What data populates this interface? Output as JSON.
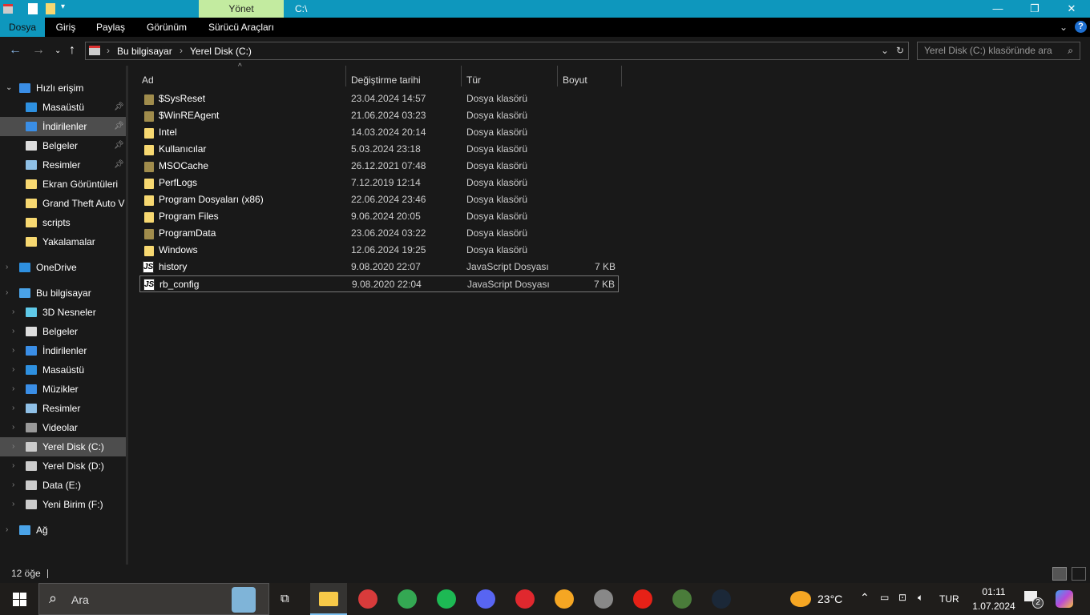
{
  "titlebar": {
    "context_tab": "Yönet",
    "title": "C:\\",
    "minimize": "—",
    "maximize": "❐",
    "close": "✕"
  },
  "ribbon": {
    "tabs": [
      "Dosya",
      "Giriş",
      "Paylaş",
      "Görünüm",
      "Sürücü Araçları"
    ],
    "help": "?",
    "collapse": "⌄"
  },
  "address": {
    "breadcrumbs": [
      "Bu bilgisayar",
      "Yerel Disk (C:)"
    ],
    "search_placeholder": "Yerel Disk (C:) klasöründe ara"
  },
  "sidebar": {
    "items": [
      {
        "label": "Hızlı erişim",
        "level": 0,
        "icon": "star-icon",
        "color": "#3a8ee6"
      },
      {
        "label": "Masaüstü",
        "level": 1,
        "icon": "desktop-icon",
        "color": "#2e90e0",
        "pinned": true
      },
      {
        "label": "İndirilenler",
        "level": 1,
        "icon": "download-icon",
        "color": "#3a8ee6",
        "pinned": true,
        "selected": true
      },
      {
        "label": "Belgeler",
        "level": 1,
        "icon": "document-icon",
        "color": "#dddddd",
        "pinned": true
      },
      {
        "label": "Resimler",
        "level": 1,
        "icon": "pictures-icon",
        "color": "#8fc0e6",
        "pinned": true
      },
      {
        "label": "Ekran Görüntüleri",
        "level": 1,
        "icon": "folder-icon",
        "color": "#f7d871"
      },
      {
        "label": "Grand Theft Auto V",
        "level": 1,
        "icon": "folder-icon",
        "color": "#f7d871"
      },
      {
        "label": "scripts",
        "level": 1,
        "icon": "folder-icon",
        "color": "#f7d871"
      },
      {
        "label": "Yakalamalar",
        "level": 1,
        "icon": "folder-icon",
        "color": "#f7d871"
      },
      {
        "label": "OneDrive",
        "level": 0,
        "icon": "cloud-icon",
        "color": "#2e90e0",
        "gap": true
      },
      {
        "label": "Bu bilgisayar",
        "level": 0,
        "icon": "computer-icon",
        "color": "#4aa3e8",
        "gap": true
      },
      {
        "label": "3D Nesneler",
        "level": 1,
        "icon": "cube-icon",
        "color": "#5fc9e8"
      },
      {
        "label": "Belgeler",
        "level": 1,
        "icon": "document-icon",
        "color": "#dddddd"
      },
      {
        "label": "İndirilenler",
        "level": 1,
        "icon": "download-icon",
        "color": "#3a8ee6"
      },
      {
        "label": "Masaüstü",
        "level": 1,
        "icon": "desktop-icon",
        "color": "#2e90e0"
      },
      {
        "label": "Müzikler",
        "level": 1,
        "icon": "music-icon",
        "color": "#3a8ee6"
      },
      {
        "label": "Resimler",
        "level": 1,
        "icon": "pictures-icon",
        "color": "#8fc0e6"
      },
      {
        "label": "Videolar",
        "level": 1,
        "icon": "video-icon",
        "color": "#999999"
      },
      {
        "label": "Yerel Disk (C:)",
        "level": 1,
        "icon": "drive-icon",
        "color": "#cccccc",
        "selected": true
      },
      {
        "label": "Yerel Disk (D:)",
        "level": 1,
        "icon": "drive-icon",
        "color": "#cccccc"
      },
      {
        "label": "Data (E:)",
        "level": 1,
        "icon": "drive-icon",
        "color": "#cccccc"
      },
      {
        "label": "Yeni Birim (F:)",
        "level": 1,
        "icon": "drive-icon",
        "color": "#cccccc"
      },
      {
        "label": "Ağ",
        "level": 0,
        "icon": "network-icon",
        "color": "#4aa3e8",
        "gap": true
      }
    ]
  },
  "columns": [
    "Ad",
    "Değiştirme tarihi",
    "Tür",
    "Boyut"
  ],
  "files": [
    {
      "name": "$SysReset",
      "date": "23.04.2024 14:57",
      "type": "Dosya klasörü",
      "size": "",
      "kind": "folder-hidden"
    },
    {
      "name": "$WinREAgent",
      "date": "21.06.2024 03:23",
      "type": "Dosya klasörü",
      "size": "",
      "kind": "folder-hidden"
    },
    {
      "name": "Intel",
      "date": "14.03.2024 20:14",
      "type": "Dosya klasörü",
      "size": "",
      "kind": "folder"
    },
    {
      "name": "Kullanıcılar",
      "date": "5.03.2024 23:18",
      "type": "Dosya klasörü",
      "size": "",
      "kind": "folder"
    },
    {
      "name": "MSOCache",
      "date": "26.12.2021 07:48",
      "type": "Dosya klasörü",
      "size": "",
      "kind": "folder-hidden"
    },
    {
      "name": "PerfLogs",
      "date": "7.12.2019 12:14",
      "type": "Dosya klasörü",
      "size": "",
      "kind": "folder"
    },
    {
      "name": "Program Dosyaları (x86)",
      "date": "22.06.2024 23:46",
      "type": "Dosya klasörü",
      "size": "",
      "kind": "folder"
    },
    {
      "name": "Program Files",
      "date": "9.06.2024 20:05",
      "type": "Dosya klasörü",
      "size": "",
      "kind": "folder"
    },
    {
      "name": "ProgramData",
      "date": "23.06.2024 03:22",
      "type": "Dosya klasörü",
      "size": "",
      "kind": "folder-hidden"
    },
    {
      "name": "Windows",
      "date": "12.06.2024 19:25",
      "type": "Dosya klasörü",
      "size": "",
      "kind": "folder"
    },
    {
      "name": "history",
      "date": "9.08.2020 22:07",
      "type": "JavaScript Dosyası",
      "size": "7 KB",
      "kind": "js"
    },
    {
      "name": "rb_config",
      "date": "9.08.2020 22:04",
      "type": "JavaScript Dosyası",
      "size": "7 KB",
      "kind": "js",
      "selected": true
    }
  ],
  "status": {
    "count": "12 öğe"
  },
  "taskbar": {
    "search_placeholder": "Ara",
    "weather": "23°C",
    "language": "TUR",
    "time": "01:11",
    "date": "1.07.2024",
    "notifications": "2",
    "apps": [
      {
        "name": "file-explorer",
        "color": "#f7c948"
      },
      {
        "name": "app-red",
        "color": "#d83b3b"
      },
      {
        "name": "chrome",
        "color": "#34a853"
      },
      {
        "name": "spotify",
        "color": "#1db954"
      },
      {
        "name": "discord",
        "color": "#5865f2"
      },
      {
        "name": "amd",
        "color": "#e0282e"
      },
      {
        "name": "app-orange",
        "color": "#f5a623"
      },
      {
        "name": "app-car",
        "color": "#888888"
      },
      {
        "name": "app-youtube",
        "color": "#e62117"
      },
      {
        "name": "gta-v",
        "color": "#4a7c3a"
      },
      {
        "name": "steam",
        "color": "#1b2838"
      }
    ]
  }
}
